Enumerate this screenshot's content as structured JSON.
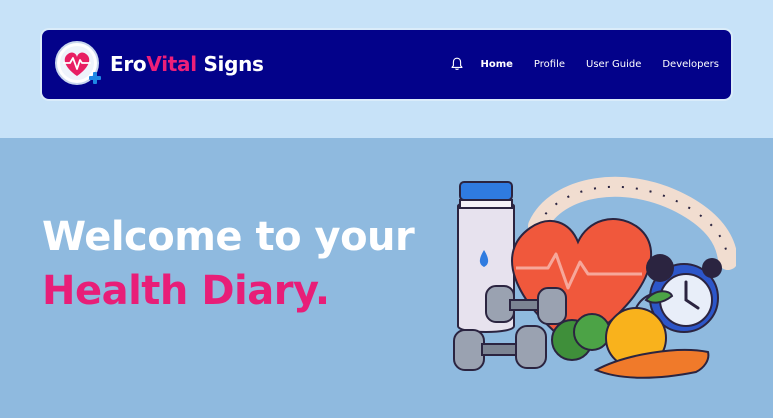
{
  "brand": {
    "name_part1": "Ero",
    "name_accent": "Vital",
    "name_part2": " Signs",
    "logo_icon": "heart-pulse-logo",
    "accent_color": "#ee1f79",
    "nav_bg_color": "#03028a"
  },
  "nav": {
    "bell_icon": "bell-icon",
    "items": [
      {
        "label": "Home",
        "active": true
      },
      {
        "label": "Profile",
        "active": false
      },
      {
        "label": "User Guide",
        "active": false
      },
      {
        "label": "Developers",
        "active": false
      }
    ]
  },
  "hero": {
    "line1": "Welcome to your",
    "line2": "Health Diary.",
    "line2_color": "#e81e78",
    "background_color": "#8fbadf",
    "illustration_icon": "health-fitness-illustration"
  }
}
